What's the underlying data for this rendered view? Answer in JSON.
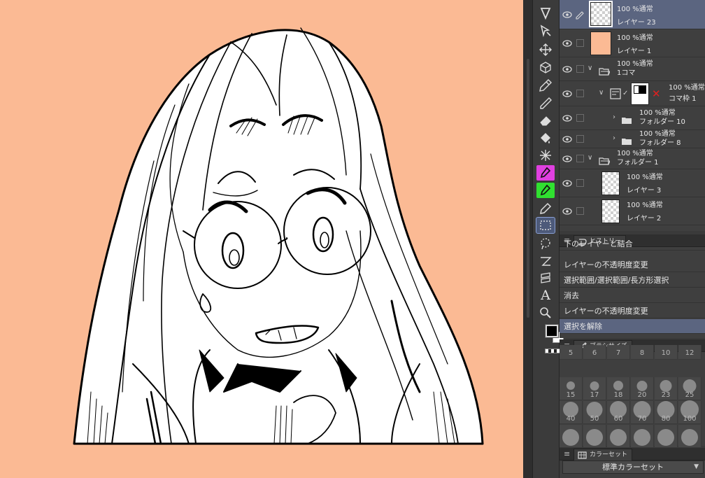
{
  "colors": {
    "canvas_bg": "#fbba94",
    "panel_bg": "#3f3f3f",
    "selected": "#5b6580"
  },
  "tools": [
    {
      "name": "operation-tool"
    },
    {
      "name": "layer-move-tool"
    },
    {
      "name": "move-tool"
    },
    {
      "name": "3d-tool"
    },
    {
      "name": "pen-tool"
    },
    {
      "name": "pencil-tool"
    },
    {
      "name": "eraser-tool"
    },
    {
      "name": "fill-tool"
    },
    {
      "name": "spark-tool"
    },
    {
      "name": "magenta-color-tool"
    },
    {
      "name": "green-color-tool"
    },
    {
      "name": "marker-tool"
    },
    {
      "name": "rect-select-tool"
    },
    {
      "name": "lasso-tool"
    },
    {
      "name": "ruler-tool"
    },
    {
      "name": "frame-tool"
    },
    {
      "name": "text-tool",
      "glyph": "A"
    },
    {
      "name": "zoom-tool"
    }
  ],
  "layers": [
    {
      "blend": "100 %通常",
      "name": "レイヤー 23",
      "selected": true
    },
    {
      "blend": "100 %通常",
      "name": "レイヤー 1"
    },
    {
      "blend": "100 %通常",
      "name": "1コマ"
    },
    {
      "blend": "100 %通常",
      "name": "コマ枠 1"
    },
    {
      "blend": "100 %通常",
      "name": "フォルダー 10"
    },
    {
      "blend": "100 %通常",
      "name": "フォルダー 8"
    },
    {
      "blend": "100 %通常",
      "name": "フォルダー 1"
    },
    {
      "blend": "100 %通常",
      "name": "レイヤー 3"
    },
    {
      "blend": "100 %通常",
      "name": "レイヤー 2"
    }
  ],
  "history": {
    "tab_label": "ヒストリー",
    "items": [
      "下のレイヤーと結合",
      "レイヤーの不透明度変更",
      "選択範囲/選択範囲/長方形選択",
      "消去",
      "レイヤーの不透明度変更",
      "選択を解除"
    ],
    "selected_index": 5
  },
  "brush_size": {
    "tab_label": "ブラシサイズ",
    "sizes": [
      "5",
      "6",
      "7",
      "8",
      "10",
      "12",
      "15",
      "17",
      "18",
      "20",
      "23",
      "25",
      "40",
      "50",
      "60",
      "70",
      "80",
      "100",
      "",
      "",
      "",
      "",
      "",
      ""
    ]
  },
  "color_set": {
    "tab_label": "カラーセット",
    "selected": "標準カラーセット"
  }
}
